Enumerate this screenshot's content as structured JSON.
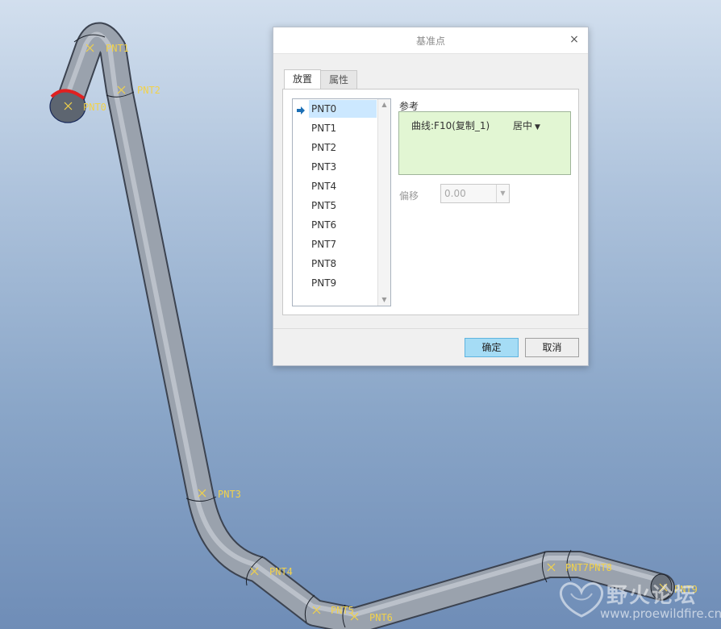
{
  "viewport": {
    "points": [
      "PNT0",
      "PNT1",
      "PNT2",
      "PNT3",
      "PNT4",
      "PNT5",
      "PNT6",
      "PNT7",
      "PNT8",
      "PNT9"
    ]
  },
  "dialog": {
    "title": "基准点",
    "close_glyph": "×",
    "tabs": [
      "放置",
      "属性"
    ],
    "active_tab": "放置",
    "point_list": [
      "PNT0",
      "PNT1",
      "PNT2",
      "PNT3",
      "PNT4",
      "PNT5",
      "PNT6",
      "PNT7",
      "PNT8",
      "PNT9"
    ],
    "selected_point": "PNT0",
    "reference": {
      "label": "参考",
      "curve": "曲线:F10(复制_1)",
      "mode": "居中"
    },
    "offset": {
      "label": "偏移",
      "value": "0.00"
    },
    "buttons": {
      "ok": "确定",
      "cancel": "取消"
    }
  },
  "watermark": {
    "name": "野火论坛",
    "url": "www.proewildfire.cn"
  },
  "colors": {
    "point_label": "#f2d24a",
    "selected_row": "#cce8ff",
    "reference_box": "#e2f6d3",
    "ok_button": "#a5dcf5",
    "highlight_arc": "#e02020"
  }
}
